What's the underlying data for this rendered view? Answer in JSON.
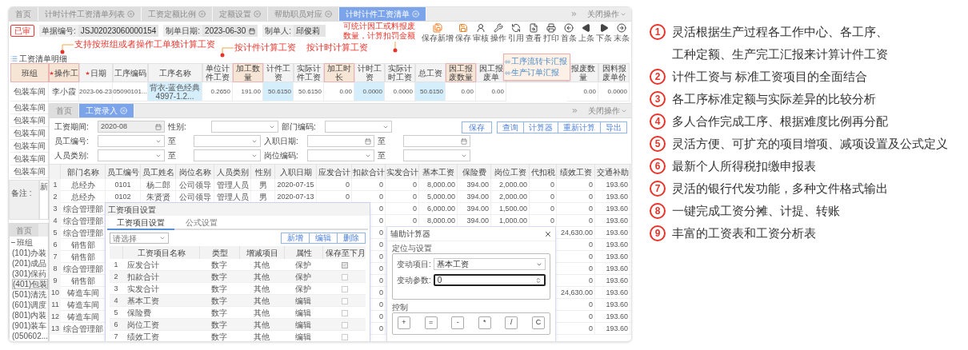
{
  "back_window": {
    "tabs": [
      {
        "label": "首页",
        "selected": false,
        "closable": false
      },
      {
        "label": "计时计件工资清单列表",
        "selected": false,
        "closable": true
      },
      {
        "label": "工资定额比例",
        "selected": false,
        "closable": true
      },
      {
        "label": "定额设置",
        "selected": false,
        "closable": true
      },
      {
        "label": "帮助职员对应",
        "selected": false,
        "closable": true
      },
      {
        "label": "计时计件工资清单",
        "selected": true,
        "closable": true
      }
    ],
    "close_menu": "关闭操作",
    "status_stamp": "已审",
    "fields": [
      {
        "label": "单据编号:",
        "value": "JSJ02023060000154",
        "kind": "text"
      },
      {
        "label": "制单日期:",
        "value": "2023-06-30",
        "kind": "date"
      },
      {
        "label": "制单人:",
        "value": "邱俊莉",
        "kind": "text"
      }
    ],
    "toolbar": [
      {
        "label": "保存新增",
        "kind": "save-new"
      },
      {
        "label": "保存",
        "kind": "save"
      },
      {
        "label": "审核",
        "kind": "approve"
      },
      {
        "label": "操作",
        "kind": "operate"
      },
      {
        "label": "引用",
        "kind": "reference"
      },
      {
        "label": "查看",
        "kind": "view"
      },
      {
        "label": "打印",
        "kind": "print"
      },
      {
        "label": "首条",
        "kind": "first"
      },
      {
        "label": "上条",
        "kind": "prev"
      },
      {
        "label": "下条",
        "kind": "next"
      },
      {
        "label": "末条",
        "kind": "last"
      }
    ],
    "annotations": [
      "支持按班组或者操作工单独计算工资",
      "按计件计算工资",
      "按计时计算工资",
      "可统计因工或料报废数量，计算扣罚金额"
    ],
    "section_title": "工资清单明细",
    "grid": {
      "columns": [
        {
          "label": "班组",
          "required": false,
          "highlighted": true,
          "tinted": false
        },
        {
          "label": "操作工",
          "required": true,
          "highlighted": true,
          "tinted": false
        },
        {
          "label": "日期",
          "required": true,
          "highlighted": false,
          "tinted": false
        },
        {
          "label": "工序编码",
          "required": false,
          "highlighted": false,
          "tinted": false
        },
        {
          "label": "工序名称",
          "required": false,
          "highlighted": false,
          "tinted": true
        },
        {
          "label": "单位计件工资",
          "required": false,
          "highlighted": false,
          "tinted": false
        },
        {
          "label": "加工数量",
          "required": false,
          "highlighted": true,
          "tinted": false
        },
        {
          "label": "计件工资",
          "required": false,
          "highlighted": false,
          "tinted": true
        },
        {
          "label": "实际计件工资",
          "required": false,
          "highlighted": false,
          "tinted": false
        },
        {
          "label": "加工时长",
          "required": false,
          "highlighted": true,
          "tinted": false
        },
        {
          "label": "计时工资",
          "required": false,
          "highlighted": false,
          "tinted": true
        },
        {
          "label": "实际计时工资",
          "required": false,
          "highlighted": false,
          "tinted": false
        },
        {
          "label": "总工资",
          "required": false,
          "highlighted": false,
          "tinted": true
        },
        {
          "label": "因工报废数量",
          "required": false,
          "highlighted": true,
          "tinted": false
        },
        {
          "label": "因工报废单",
          "required": false,
          "highlighted": false,
          "tinted": false
        },
        null,
        {
          "label": "报废数量",
          "required": false,
          "highlighted": false,
          "tinted": false
        },
        {
          "label": "因料报废单价",
          "required": false,
          "highlighted": false,
          "tinted": false
        }
      ],
      "rows": [
        [
          "包装车间",
          "李小霞",
          "2023-06-23",
          "05090101...",
          "背衣-蓝色经典4997-1.2...",
          "0.2650",
          "191.00",
          "50.6150",
          "50.6150",
          "0.00",
          "0.0000",
          "0.0000",
          "50.6150",
          "0.00",
          "0.00",
          null,
          "0.00",
          "0.0000"
        ],
        [
          "包装车间"
        ],
        [
          "包装车间"
        ],
        [
          "包装车间"
        ],
        [
          "包装车间"
        ],
        [
          "包装车间"
        ],
        [
          "包装车间"
        ]
      ]
    },
    "popup": [
      "工序流转卡汇报",
      "生产订单汇报"
    ],
    "remark_label": "备注 :",
    "side_strip": "新"
  },
  "tree_window": {
    "tab": "首页",
    "root": {
      "label": "班组",
      "expanded": true,
      "children": [
        {
          "label": "(101)办装",
          "selected": false
        },
        {
          "label": "(201)成品",
          "selected": false
        },
        {
          "label": "(301)保药",
          "selected": false
        },
        {
          "label": "(401)包装",
          "selected": true
        },
        {
          "label": "(501)清洗",
          "selected": false
        },
        {
          "label": "(601)调度",
          "selected": false
        },
        {
          "label": "(801)内装",
          "selected": false
        },
        {
          "label": "(901)装车",
          "selected": false
        },
        {
          "label": "(050602...",
          "selected": false
        }
      ]
    }
  },
  "entry_window": {
    "tabs": [
      {
        "label": "首页",
        "selected": false,
        "closable": false
      },
      {
        "label": "工资录入",
        "selected": true,
        "closable": true
      }
    ],
    "close_menu": "关闭操作",
    "filters": [
      [
        {
          "kind": "label",
          "text": "工资期间:"
        },
        {
          "kind": "date",
          "value": "2020-08",
          "disabled": true
        },
        {
          "kind": "label",
          "text": "性别:"
        },
        {
          "kind": "select"
        },
        {
          "kind": "label",
          "text": "部门编码:"
        },
        {
          "kind": "select"
        }
      ],
      [
        {
          "kind": "label",
          "text": "员工编号:"
        },
        {
          "kind": "select"
        },
        {
          "kind": "label",
          "text": "至"
        },
        {
          "kind": "select"
        },
        {
          "kind": "label",
          "text": "入职日期:"
        },
        {
          "kind": "date"
        },
        {
          "kind": "label",
          "text": "至"
        },
        {
          "kind": "date"
        }
      ],
      [
        {
          "kind": "label",
          "text": "人员类别:"
        },
        {
          "kind": "select"
        },
        {
          "kind": "label",
          "text": "至"
        },
        {
          "kind": "select"
        },
        {
          "kind": "label",
          "text": "岗位编码:"
        },
        {
          "kind": "select"
        },
        {
          "kind": "label",
          "text": "至"
        },
        {
          "kind": "select"
        }
      ]
    ],
    "actions": [
      {
        "label": "保存",
        "kind": "single"
      },
      {
        "label": "查询",
        "kind": "grouped"
      },
      {
        "label": "计算器",
        "kind": "grouped"
      },
      {
        "label": "重新计算",
        "kind": "grouped"
      },
      {
        "label": "导出",
        "kind": "grouped"
      }
    ],
    "columns": [
      "部门名称",
      "员工编号",
      "员工姓名",
      "岗位名称",
      "人员类别",
      "性别",
      "入职日期",
      "应发合计",
      "扣款合计",
      "实发合计",
      "基本工资",
      "保险费",
      "岗位工资",
      "代扣税",
      "绩效工资",
      "交通补助"
    ],
    "rows": [
      {
        "no": "1",
        "cells": [
          "总经办",
          "0101",
          "杨二郎",
          "公司领导",
          "管理人员",
          "男",
          "2020-07-15",
          "0",
          "0",
          "0",
          "8,000.00",
          "394.00",
          "2,000.00",
          "0",
          "0",
          "193.60"
        ]
      },
      {
        "no": "2",
        "cells": [
          "总经办",
          "0102",
          "朱贤贤",
          "公司领导",
          "管理人员",
          "男",
          "2020-07-13",
          "0",
          "0",
          "0",
          "5,000.00",
          "394.00",
          "2,000.00",
          "0",
          "0",
          "193.60"
        ]
      },
      {
        "no": "3",
        "cells": [
          "综合管理部",
          null,
          null,
          null,
          null,
          null,
          null,
          null,
          "0",
          "0",
          "6,000.00",
          "394.00",
          "1,500.00",
          "0",
          "0",
          "193.60"
        ]
      },
      {
        "no": "4",
        "cells": [
          "综合管理部",
          null,
          null,
          null,
          null,
          null,
          null,
          null,
          "0",
          "0",
          "8,000.00",
          "394.00",
          "1,000.00",
          "0",
          "0",
          "193.60"
        ]
      },
      {
        "no": "5",
        "cells": [
          "综合管理部",
          null,
          null,
          null,
          null,
          null,
          null,
          null,
          "0",
          null,
          null,
          null,
          null,
          null,
          "24,630.00",
          "193.60"
        ]
      },
      {
        "no": "6",
        "cells": [
          "销售部",
          null,
          null,
          null,
          null,
          null,
          null,
          null,
          "0",
          null,
          null,
          null,
          null,
          null,
          "0",
          "193.60"
        ]
      },
      {
        "no": "7",
        "cells": [
          "销售部",
          null,
          null,
          null,
          null,
          null,
          null,
          null,
          "0",
          null,
          null,
          null,
          null,
          null,
          "0",
          "193.60"
        ]
      },
      {
        "no": "8",
        "cells": [
          "综合管理部",
          null,
          null,
          null,
          null,
          null,
          null,
          null,
          "0",
          null,
          null,
          null,
          null,
          null,
          "0",
          "193.60"
        ]
      },
      {
        "no": "9",
        "cells": [
          "销售部",
          null,
          null,
          null,
          null,
          null,
          null,
          null,
          "0",
          null,
          null,
          null,
          null,
          null,
          "0",
          "193.60"
        ]
      },
      {
        "no": "10",
        "cells": [
          "铸造车间",
          null,
          null,
          null,
          null,
          null,
          null,
          null,
          "0",
          null,
          null,
          null,
          null,
          null,
          "24,630.00",
          "193.60"
        ]
      },
      {
        "no": "11",
        "cells": [
          "铸造车间",
          null,
          null,
          null,
          null,
          null,
          null,
          null,
          "0",
          null,
          null,
          null,
          null,
          null,
          "0",
          "193.60"
        ]
      },
      {
        "no": "12",
        "cells": [
          "铸造车间",
          null,
          null,
          null,
          null,
          null,
          null,
          null,
          "0",
          null,
          null,
          null,
          null,
          null,
          "0",
          "193.60"
        ]
      },
      {
        "no": "13",
        "cells": [
          "综合管理部",
          null,
          null,
          null,
          null,
          null,
          null,
          null,
          "0",
          null,
          null,
          null,
          null,
          null,
          "0",
          "193.60"
        ]
      }
    ]
  },
  "item_dialog": {
    "title": "工资项目设置",
    "tabs": [
      {
        "label": "工资项目设置",
        "selected": true
      },
      {
        "label": "公式设置",
        "selected": false
      }
    ],
    "select_placeholder": "请选择",
    "buttons": [
      "新增",
      "编辑",
      "删除"
    ],
    "columns": [
      "工资项目名称",
      "类型",
      "增减项目",
      "属性",
      "保存至下月"
    ],
    "rows": [
      {
        "no": "1",
        "name": "应发合计",
        "type": "数字",
        "change": "其他",
        "attr": "保护",
        "carry": true
      },
      {
        "no": "2",
        "name": "扣款合计",
        "type": "数字",
        "change": "其他",
        "attr": "保护",
        "carry": false
      },
      {
        "no": "3",
        "name": "实发合计",
        "type": "数字",
        "change": "其他",
        "attr": "保护",
        "carry": false
      },
      {
        "no": "4",
        "name": "基本工资",
        "type": "数字",
        "change": "其他",
        "attr": "编辑",
        "carry": false
      },
      {
        "no": "5",
        "name": "保险费",
        "type": "数字",
        "change": "其他",
        "attr": "编辑",
        "carry": false
      },
      {
        "no": "6",
        "name": "岗位工资",
        "type": "数字",
        "change": "其他",
        "attr": "编辑",
        "carry": false
      },
      {
        "no": "7",
        "name": "绩效工资",
        "type": "数字",
        "change": "其他",
        "attr": "编辑",
        "carry": false
      }
    ]
  },
  "calculator": {
    "title": "辅助计算器",
    "settings_legend": "定位与设置",
    "fields": [
      {
        "label": "变动项目:",
        "value": "基本工资",
        "kind": "select",
        "focused": false
      },
      {
        "label": "变动参数:",
        "value": "0",
        "kind": "number",
        "focused": true
      }
    ],
    "control_legend": "控制",
    "keys": [
      "+",
      "=",
      "-",
      "*",
      "/",
      "C"
    ]
  },
  "features": [
    {
      "number": "1",
      "lines": [
        "灵活根据生产过程各工作中心、各工序、",
        "工种定额、生产完工汇报来计算计件工资"
      ]
    },
    {
      "number": "2",
      "lines": [
        "计件工资与 标准工资项目的全面结合"
      ]
    },
    {
      "number": "3",
      "lines": [
        "各工序标准定额与实际差异的比较分析"
      ]
    },
    {
      "number": "4",
      "lines": [
        "多人合作完成工序、根据难度比例再分配"
      ]
    },
    {
      "number": "5",
      "lines": [
        "灵活方便、可扩充的项目增项、减项设置及公式定义"
      ]
    },
    {
      "number": "6",
      "lines": [
        "最新个人所得税扣缴申报表"
      ]
    },
    {
      "number": "7",
      "lines": [
        "灵活的银行代发功能，多种文件格式输出"
      ]
    },
    {
      "number": "8",
      "lines": [
        "一键完成工资分摊、计提、转账"
      ]
    },
    {
      "number": "9",
      "lines": [
        "丰富的工资表和工资分析表"
      ]
    }
  ]
}
